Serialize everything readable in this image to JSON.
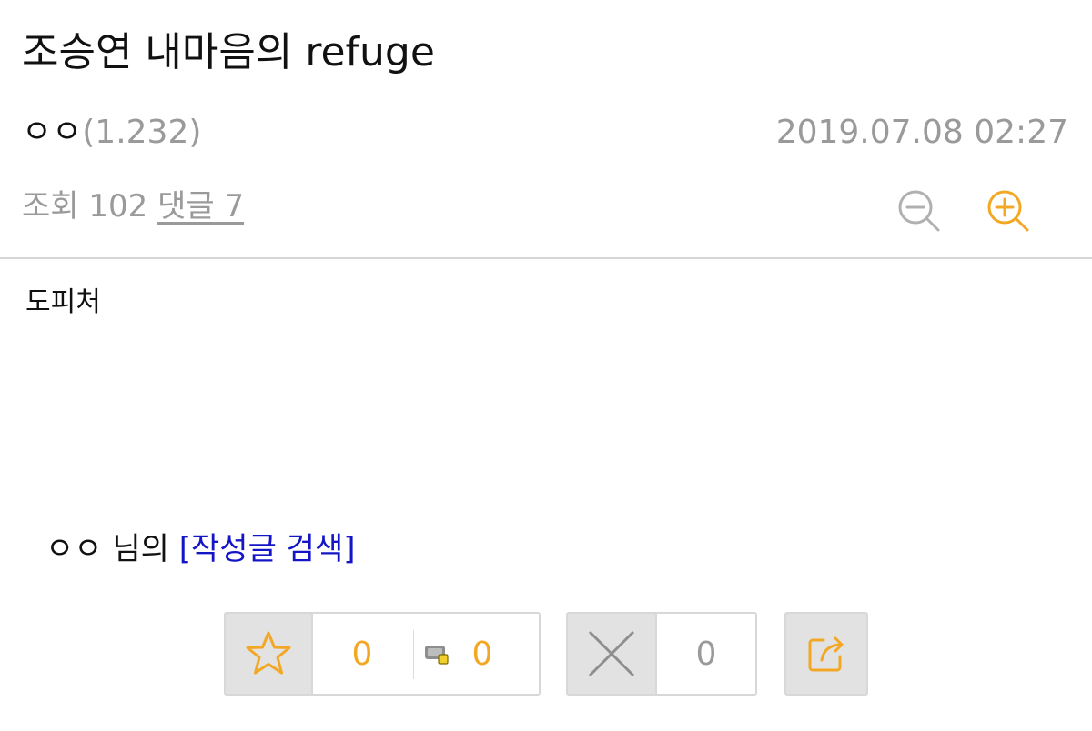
{
  "post": {
    "title": "조승연 내마음의 refuge",
    "author": "ㅇㅇ",
    "author_ip": "(1.232)",
    "date": "2019.07.08 02:27",
    "views_label": "조회 102",
    "comments_label": "댓글 7",
    "body": "도피처"
  },
  "author_search": {
    "prefix": "ㅇㅇ 님의 ",
    "link": "[작성글 검색]"
  },
  "votes": {
    "recommend_count": "0",
    "fixed_recommend_count": "0",
    "not_recommend_count": "0"
  },
  "icons": {
    "zoom_out": "zoom-out-icon",
    "zoom_in": "zoom-in-icon",
    "recommend": "star-icon",
    "fixed_recommend": "badge-icon",
    "not_recommend": "x-icon",
    "share": "share-icon"
  },
  "colors": {
    "accent": "#f3a825",
    "link": "#1515c8",
    "muted": "#9a9a9a"
  }
}
